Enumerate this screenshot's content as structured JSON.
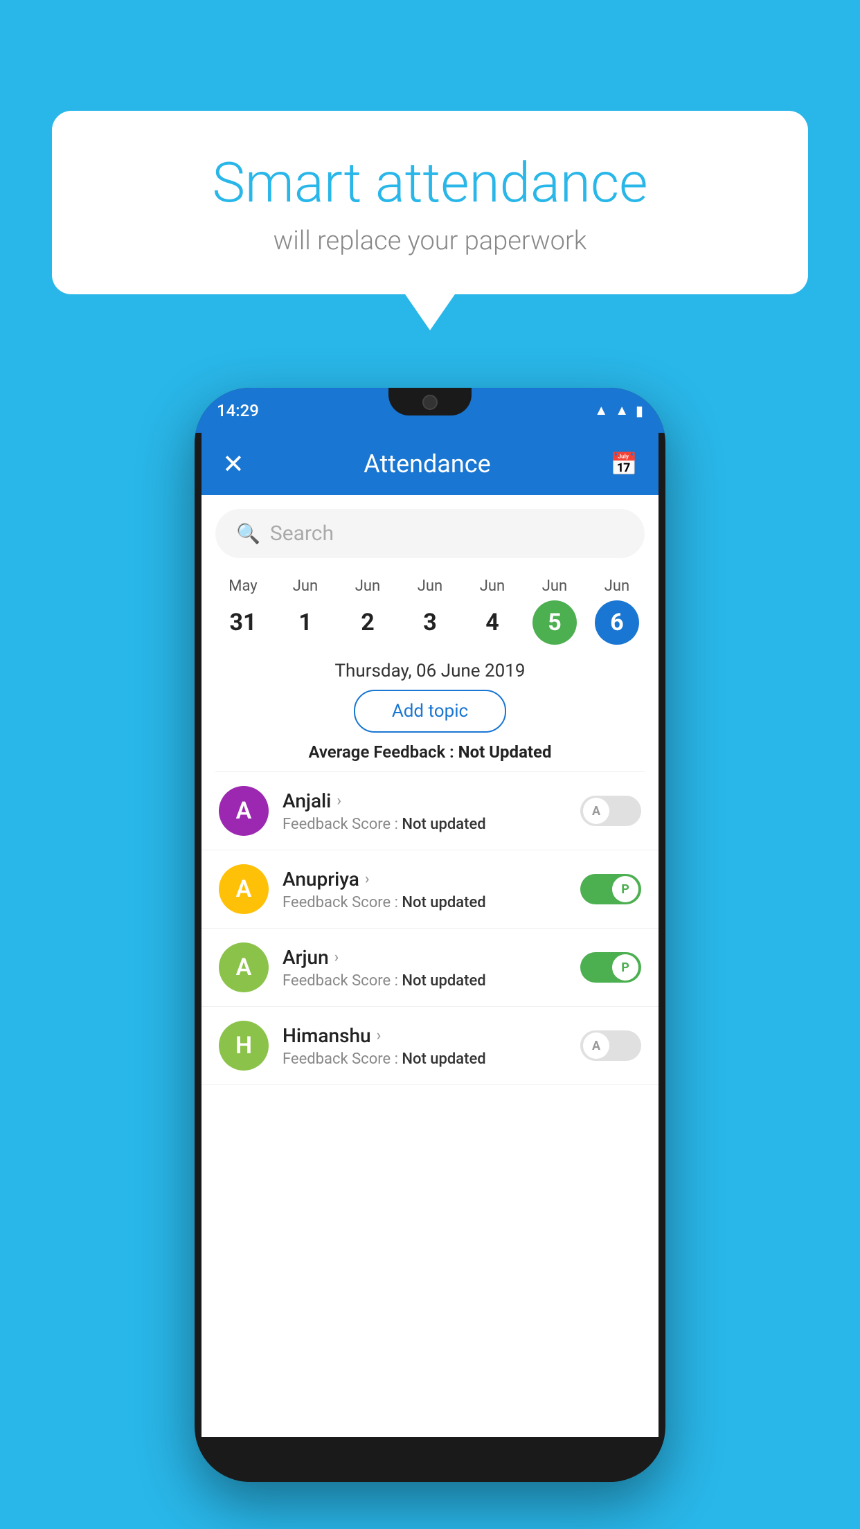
{
  "background_color": "#29B6E8",
  "speech_bubble": {
    "title": "Smart attendance",
    "subtitle": "will replace your paperwork"
  },
  "phone": {
    "status_bar": {
      "time": "14:29",
      "icons": [
        "wifi",
        "signal",
        "battery"
      ]
    },
    "header": {
      "title": "Attendance",
      "close_label": "×",
      "calendar_icon": "📅"
    },
    "search": {
      "placeholder": "Search"
    },
    "calendar": {
      "days": [
        {
          "month": "May",
          "date": "31",
          "style": "normal"
        },
        {
          "month": "Jun",
          "date": "1",
          "style": "normal"
        },
        {
          "month": "Jun",
          "date": "2",
          "style": "normal"
        },
        {
          "month": "Jun",
          "date": "3",
          "style": "normal"
        },
        {
          "month": "Jun",
          "date": "4",
          "style": "normal"
        },
        {
          "month": "Jun",
          "date": "5",
          "style": "green"
        },
        {
          "month": "Jun",
          "date": "6",
          "style": "blue"
        }
      ]
    },
    "selected_date": "Thursday, 06 June 2019",
    "add_topic_label": "Add topic",
    "average_feedback_label": "Average Feedback :",
    "average_feedback_value": "Not Updated",
    "students": [
      {
        "name": "Anjali",
        "avatar_letter": "A",
        "avatar_color": "#9C27B0",
        "feedback_label": "Feedback Score :",
        "feedback_value": "Not updated",
        "toggle_state": "off",
        "toggle_label": "A"
      },
      {
        "name": "Anupriya",
        "avatar_letter": "A",
        "avatar_color": "#FFC107",
        "feedback_label": "Feedback Score :",
        "feedback_value": "Not updated",
        "toggle_state": "on",
        "toggle_label": "P"
      },
      {
        "name": "Arjun",
        "avatar_letter": "A",
        "avatar_color": "#8BC34A",
        "feedback_label": "Feedback Score :",
        "feedback_value": "Not updated",
        "toggle_state": "on",
        "toggle_label": "P"
      },
      {
        "name": "Himanshu",
        "avatar_letter": "H",
        "avatar_color": "#8BC34A",
        "feedback_label": "Feedback Score :",
        "feedback_value": "Not updated",
        "toggle_state": "off",
        "toggle_label": "A"
      }
    ]
  }
}
